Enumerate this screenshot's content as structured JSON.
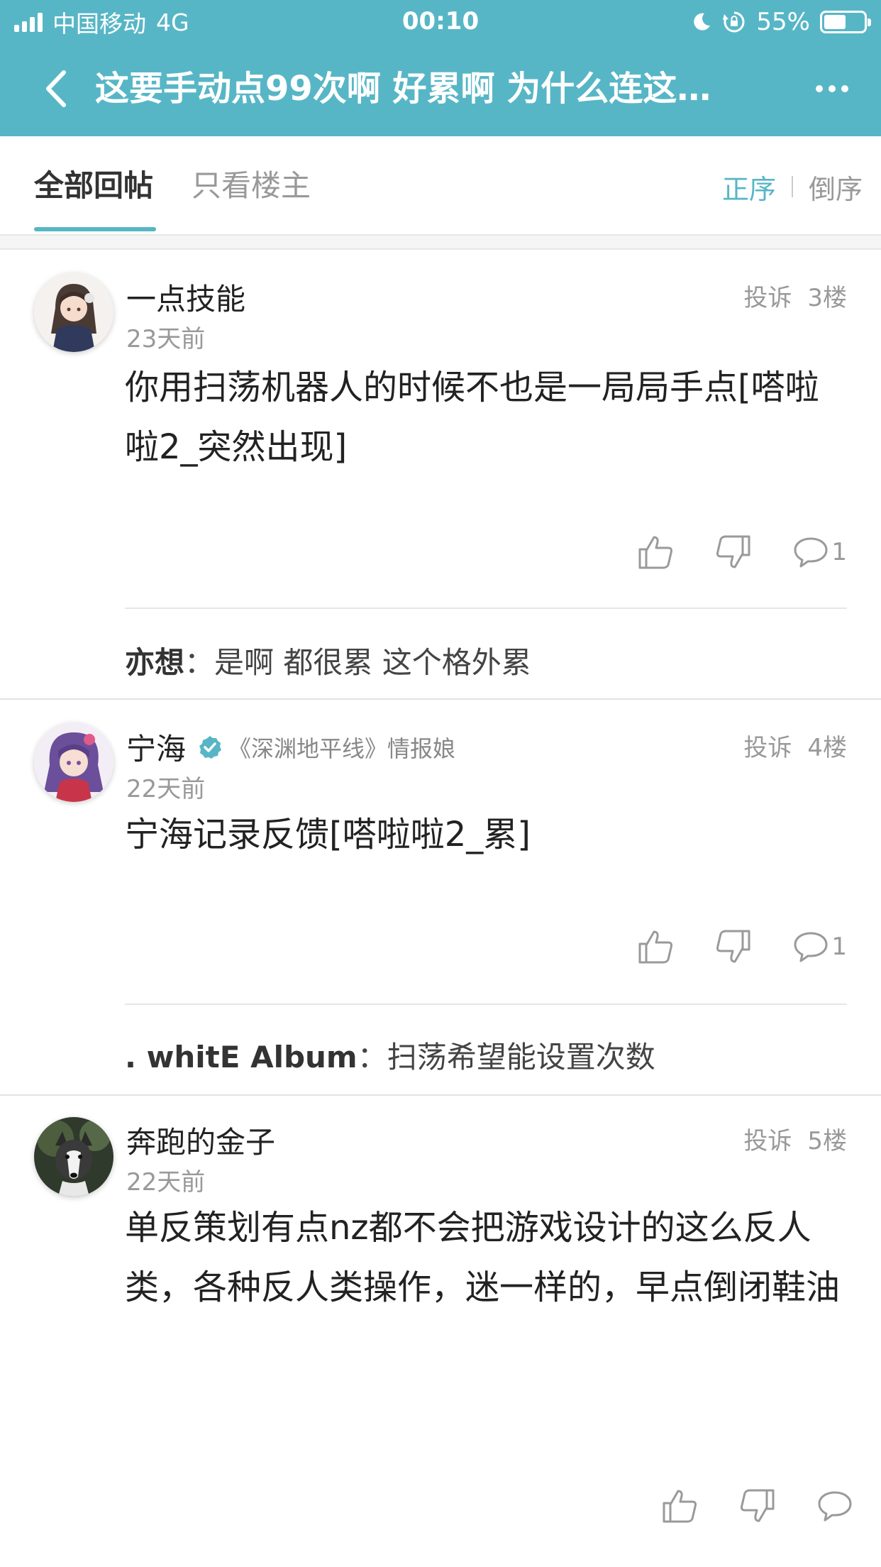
{
  "status_bar": {
    "carrier": "中国移动",
    "network": "4G",
    "time": "00:10",
    "battery": "55%",
    "battery_level": 0.55
  },
  "nav": {
    "title": "这要手动点99次啊 好累啊 为什么连这…",
    "back_icon": "chevron-left-icon",
    "more_icon": "more-horizontal-icon"
  },
  "tabs": {
    "all": "全部回帖",
    "op_only": "只看楼主",
    "sort_asc": "正序",
    "sort_desc": "倒序"
  },
  "posts": [
    {
      "username": "一点技能",
      "time": "23天前",
      "report": "投诉",
      "floor": "3楼",
      "content": "你用扫荡机器人的时候不也是一局局手点[嗒啦啦2_突然出现]",
      "comment_count": "1",
      "reply": {
        "user": "亦想",
        "sep": "：",
        "text": "是啊 都很累 这个格外累"
      }
    },
    {
      "username": "宁海",
      "verified": true,
      "badge": "《深渊地平线》情报娘",
      "time": "22天前",
      "report": "投诉",
      "floor": "4楼",
      "content": "宁海记录反馈[嗒啦啦2_累]",
      "comment_count": "1",
      "reply": {
        "user": ". whitE Album",
        "sep": "：",
        "text": "扫荡希望能设置次数"
      }
    },
    {
      "username": "奔跑的金子",
      "time": "22天前",
      "report": "投诉",
      "floor": "5楼",
      "content": "单反策划有点nz都不会把游戏设计的这么反人类，各种反人类操作，迷一样的，早点倒闭鞋油",
      "comment_count": ""
    }
  ],
  "colors": {
    "accent": "#57b6c6",
    "text": "#222222",
    "muted": "#999999"
  }
}
